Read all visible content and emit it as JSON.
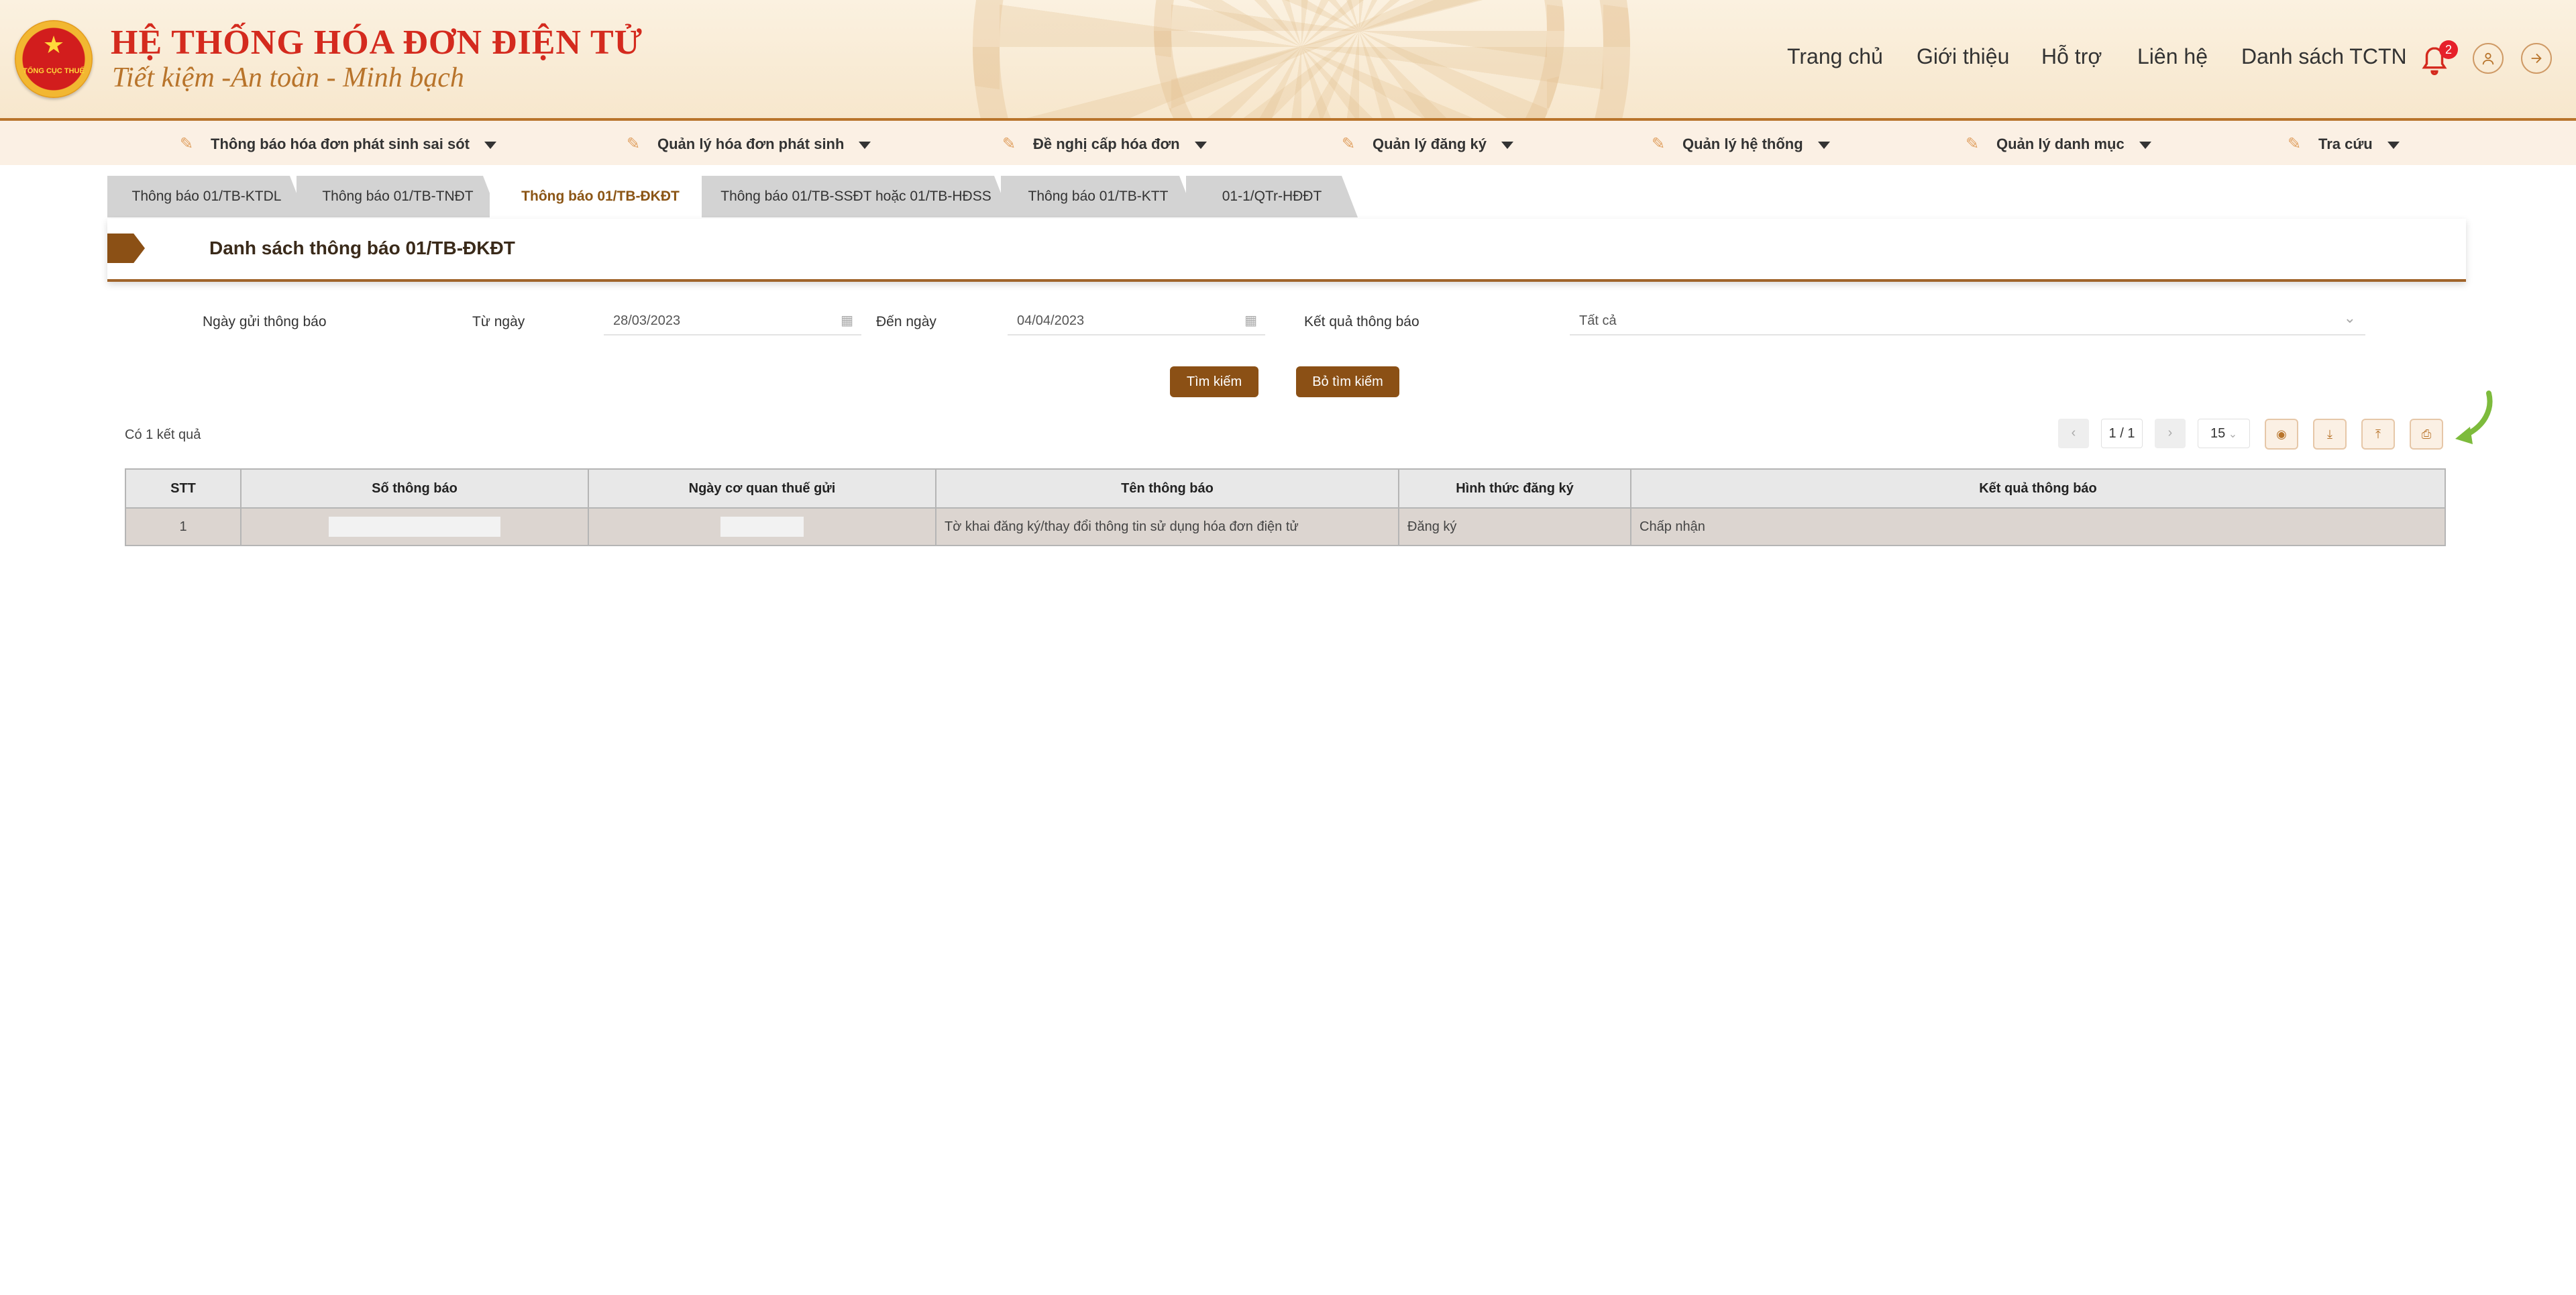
{
  "header": {
    "title": "HỆ THỐNG HÓA ĐƠN ĐIỆN TỬ",
    "slogan": "Tiết kiệm -An toàn - Minh bạch",
    "nav": [
      "Trang chủ",
      "Giới thiệu",
      "Hỗ trợ",
      "Liên hệ",
      "Danh sách TCTN"
    ],
    "notification_count": "2"
  },
  "menu": [
    {
      "label": "Thông báo hóa đơn phát sinh sai sót"
    },
    {
      "label": "Quản lý hóa đơn phát sinh"
    },
    {
      "label": "Đề nghị cấp hóa đơn"
    },
    {
      "label": "Quản lý đăng ký"
    },
    {
      "label": "Quản lý hệ thống"
    },
    {
      "label": "Quản lý danh mục"
    },
    {
      "label": "Tra cứu"
    }
  ],
  "tabs": [
    {
      "label": "Thông báo 01/TB-KTDL"
    },
    {
      "label": "Thông báo 01/TB-TNĐT"
    },
    {
      "label": "Thông báo 01/TB-ĐKĐT"
    },
    {
      "label": "Thông báo 01/TB-SSĐT hoặc 01/TB-HĐSS"
    },
    {
      "label": "Thông báo 01/TB-KTT"
    },
    {
      "label": "01-1/QTr-HĐĐT"
    }
  ],
  "active_tab_index": 2,
  "page_title": "Danh sách thông báo 01/TB-ĐKĐT",
  "filters": {
    "send_date_label": "Ngày gửi thông báo",
    "from_label": "Từ ngày",
    "from_value": "28/03/2023",
    "to_label": "Đến ngày",
    "to_value": "04/04/2023",
    "result_label": "Kết quả thông báo",
    "result_value": "Tất cả"
  },
  "buttons": {
    "search": "Tìm kiếm",
    "clear": "Bỏ tìm kiếm"
  },
  "result_count": "Có 1 kết quả",
  "pager": {
    "page": "1 / 1",
    "page_size": "15"
  },
  "table": {
    "columns": [
      "STT",
      "Số thông báo",
      "Ngày cơ quan thuế gửi",
      "Tên thông báo",
      "Hình thức đăng ký",
      "Kết quả thông báo"
    ],
    "rows": [
      {
        "stt": "1",
        "so": "",
        "ngay": "",
        "ten": "Tờ khai đăng ký/thay đổi thông tin sử dụng hóa đơn điện tử",
        "hinh_thuc": "Đăng ký",
        "ket_qua": "Chấp nhận"
      }
    ]
  },
  "colors": {
    "brand_red": "#d42a1e",
    "brand_brown": "#8b5015",
    "accent_gold": "#b8742b",
    "hint_green": "#7dbb3c"
  },
  "icons": {
    "notification": "bell-icon",
    "user": "user-icon",
    "logout": "arrow-right-icon",
    "calendar": "calendar-icon",
    "print": "printer-icon"
  }
}
